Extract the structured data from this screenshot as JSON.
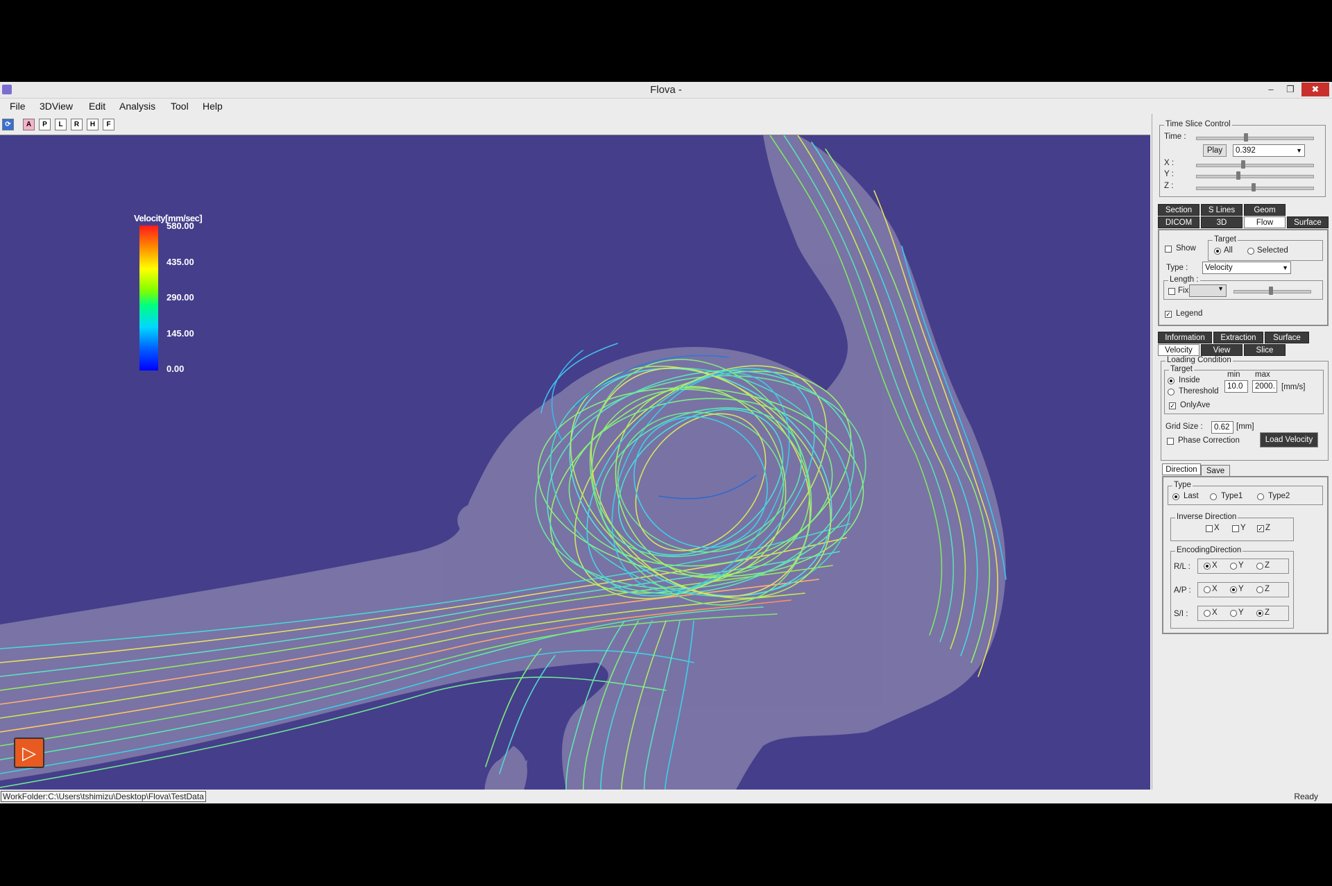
{
  "window": {
    "title": "Flova -",
    "minimize": "–",
    "restore": "❐",
    "close": "✖"
  },
  "menu": [
    "File",
    "3DView",
    "Edit",
    "Analysis",
    "Tool",
    "Help"
  ],
  "toolbar": [
    "A",
    "P",
    "L",
    "R",
    "H",
    "F"
  ],
  "legend": {
    "title": "Velocity[mm/sec]",
    "ticks": [
      "580.00",
      "435.00",
      "290.00",
      "145.00",
      "0.00"
    ]
  },
  "status": {
    "left": "WorkFolder:C:\\Users\\tshimizu\\Desktop\\Flova\\TestData",
    "right": "Ready"
  },
  "time_slice": {
    "title": "Time Slice Control",
    "time_label": "Time :",
    "play": "Play",
    "time_value": "0.392",
    "x_label": "X :",
    "y_label": "Y :",
    "z_label": "Z :",
    "time_level": 0.42,
    "x_level": 0.4,
    "y_level": 0.36,
    "z_level": 0.49
  },
  "tabs_top_row1": [
    "Section",
    "S Lines",
    "Geom"
  ],
  "tabs_top_row2": [
    "DICOM",
    "3D",
    "Flow",
    "Surface"
  ],
  "flow": {
    "show": "Show",
    "target": "Target",
    "all": "All",
    "selected": "Selected",
    "type_label": "Type :",
    "type_value": "Velocity",
    "length": "Length :",
    "fix": "Fix",
    "legend": "Legend",
    "length_level": 0.48
  },
  "tabs_mid_row1": [
    "Information",
    "Extraction",
    "Surface"
  ],
  "tabs_mid_row2": [
    "Velocity",
    "View",
    "Slice"
  ],
  "loading": {
    "title": "Loading Condition",
    "target": "Target",
    "inside": "Inside",
    "threshold": "Thereshold",
    "min_label": "min",
    "max_label": "max",
    "min_value": "10.0",
    "max_value": "2000.",
    "unit": "[mm/s]",
    "onlyave": "OnlyAve",
    "grid_label": "Grid Size :",
    "grid_value": "0.62",
    "grid_unit": "[mm]",
    "phase": "Phase Correction",
    "load": "Load Velocity"
  },
  "tabs_bottom": [
    "Direction",
    "Save"
  ],
  "direction": {
    "type": "Type",
    "last": "Last",
    "type1": "Type1",
    "type2": "Type2",
    "inverse": "Inverse Direction",
    "x": "X",
    "y": "Y",
    "z": "Z",
    "encoding": "EncodingDirection",
    "rl": "R/L :",
    "ap": "A/P :",
    "si": "S/I :"
  },
  "colors": {
    "viewport": "#453e8b",
    "vessel": "#7e77a8",
    "accent_close": "#c9302c"
  }
}
